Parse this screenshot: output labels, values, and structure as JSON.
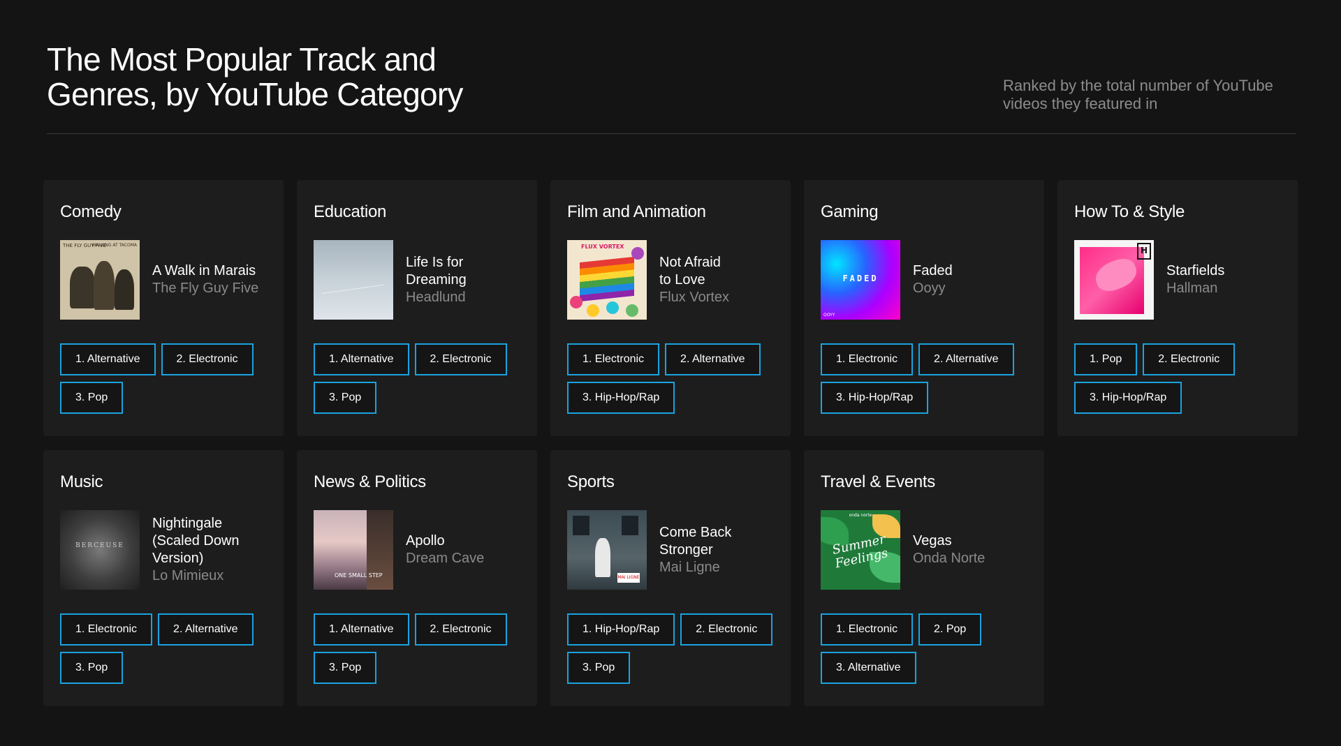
{
  "header": {
    "title_line1": "The Most Popular Track and",
    "title_line2": "Genres, by YouTube Category",
    "subtitle_line1": "Ranked by the total number of YouTube",
    "subtitle_line2": "videos they featured in"
  },
  "colors": {
    "background": "#141414",
    "card": "#1d1d1d",
    "genre_border": "#1aa3e0",
    "muted_text": "#8a8a8a"
  },
  "categories": [
    {
      "name": "Comedy",
      "track": "A Walk in Marais",
      "artist": "The Fly Guy Five",
      "cover_text": [
        "THE FLY GUY FIVE",
        "WALKING AT TACOMA"
      ],
      "genres": [
        "1. Alternative",
        "2. Electronic",
        "3. Pop"
      ]
    },
    {
      "name": "Education",
      "track": "Life Is for Dreaming",
      "artist": "Headlund",
      "cover_text": [],
      "genres": [
        "1. Alternative",
        "2. Electronic",
        "3. Pop"
      ]
    },
    {
      "name": "Film and Animation",
      "track": "Not Afraid to Love",
      "artist": "Flux Vortex",
      "cover_text": [
        "FLUX VORTEX"
      ],
      "genres": [
        "1. Electronic",
        "2. Alternative",
        "3. Hip-Hop/Rap"
      ]
    },
    {
      "name": "Gaming",
      "track": "Faded",
      "artist": "Ooyy",
      "cover_text": [
        "FADED",
        "OOYY"
      ],
      "genres": [
        "1. Electronic",
        "2. Alternative",
        "3. Hip-Hop/Rap"
      ]
    },
    {
      "name": "How To & Style",
      "track": "Starfields",
      "artist": "Hallman",
      "cover_text": [],
      "genres": [
        "1. Pop",
        "2. Electronic",
        "3. Hip-Hop/Rap"
      ]
    },
    {
      "name": "Music",
      "track": "Nightingale (Scaled Down Version)",
      "artist": "Lo Mimieux",
      "cover_text": [
        "BERCEUSE"
      ],
      "genres": [
        "1. Electronic",
        "2. Alternative",
        "3. Pop"
      ]
    },
    {
      "name": "News & Politics",
      "track": "Apollo",
      "artist": "Dream Cave",
      "cover_text": [
        "ONE SMALL STEP"
      ],
      "genres": [
        "1. Alternative",
        "2. Electronic",
        "3. Pop"
      ]
    },
    {
      "name": "Sports",
      "track": "Come Back Stronger",
      "artist": "Mai Ligne",
      "cover_text": [
        "MAI LIGNE"
      ],
      "genres": [
        "1. Hip-Hop/Rap",
        "2. Electronic",
        "3. Pop"
      ]
    },
    {
      "name": "Travel & Events",
      "track": "Vegas",
      "artist": "Onda Norte",
      "cover_text": [
        "Summer Feelings",
        "onda norte"
      ],
      "genres": [
        "1. Electronic",
        "2. Pop",
        "3. Alternative"
      ]
    }
  ]
}
